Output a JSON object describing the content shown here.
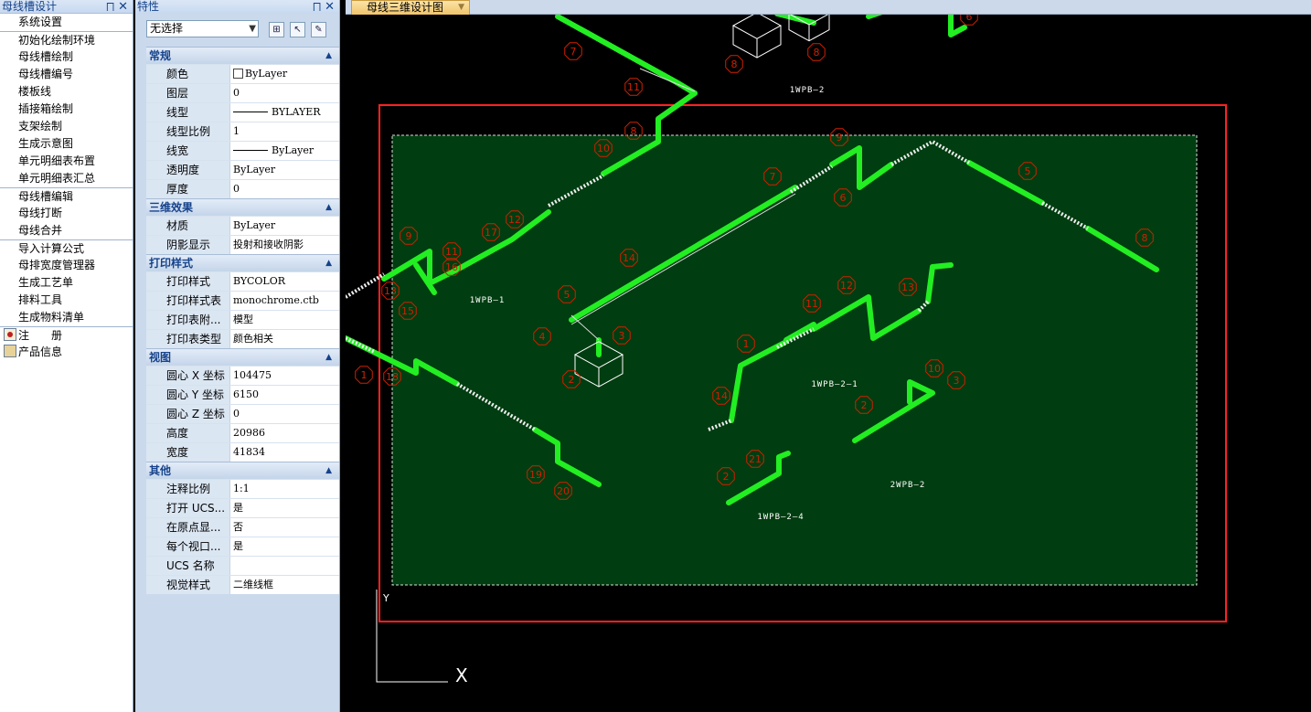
{
  "left_panel": {
    "title": "母线槽设计",
    "pin_icon": "pin-icon",
    "close_icon": "close-icon",
    "items": [
      {
        "label": "系统设置",
        "sep": false
      },
      {
        "label": "初始化绘制环境",
        "sep": true
      },
      {
        "label": "母线槽绘制",
        "sep": false
      },
      {
        "label": "母线槽编号",
        "sep": false
      },
      {
        "label": "楼板线",
        "sep": false
      },
      {
        "label": "插接箱绘制",
        "sep": false
      },
      {
        "label": "支架绘制",
        "sep": false
      },
      {
        "label": "生成示意图",
        "sep": false
      },
      {
        "label": "单元明细表布置",
        "sep": false
      },
      {
        "label": "单元明细表汇总",
        "sep": false
      },
      {
        "label": "母线槽编辑",
        "sep": true
      },
      {
        "label": "母线打断",
        "sep": false
      },
      {
        "label": "母线合并",
        "sep": false
      },
      {
        "label": "导入计算公式",
        "sep": true
      },
      {
        "label": "母排宽度管理器",
        "sep": false
      },
      {
        "label": "生成工艺单",
        "sep": false
      },
      {
        "label": "排料工具",
        "sep": false
      },
      {
        "label": "生成物料清单",
        "sep": false
      },
      {
        "label": "注　　册",
        "sep": true,
        "icon": "register-icon"
      },
      {
        "label": "产品信息",
        "sep": false,
        "icon": "product-info-icon"
      }
    ]
  },
  "properties_panel": {
    "title": "特性",
    "selection": "无选择",
    "sections": [
      {
        "name": "常规",
        "rows": [
          {
            "key": "颜色",
            "value": "ByLayer",
            "kind": "color"
          },
          {
            "key": "图层",
            "value": "0"
          },
          {
            "key": "线型",
            "value": "BYLAYER",
            "kind": "line"
          },
          {
            "key": "线型比例",
            "value": "1"
          },
          {
            "key": "线宽",
            "value": "ByLayer",
            "kind": "line"
          },
          {
            "key": "透明度",
            "value": "ByLayer"
          },
          {
            "key": "厚度",
            "value": "0"
          }
        ]
      },
      {
        "name": "三维效果",
        "rows": [
          {
            "key": "材质",
            "value": "ByLayer"
          },
          {
            "key": "阴影显示",
            "value": "投射和接收阴影"
          }
        ]
      },
      {
        "name": "打印样式",
        "rows": [
          {
            "key": "打印样式",
            "value": "BYCOLOR"
          },
          {
            "key": "打印样式表",
            "value": "monochrome.ctb"
          },
          {
            "key": "打印表附...",
            "value": "模型"
          },
          {
            "key": "打印表类型",
            "value": "颜色相关"
          }
        ]
      },
      {
        "name": "视图",
        "rows": [
          {
            "key": "圆心 X 坐标",
            "value": "104475"
          },
          {
            "key": "圆心 Y 坐标",
            "value": "6150"
          },
          {
            "key": "圆心 Z 坐标",
            "value": "0"
          },
          {
            "key": "高度",
            "value": "20986"
          },
          {
            "key": "宽度",
            "value": "41834"
          }
        ]
      },
      {
        "name": "其他",
        "rows": [
          {
            "key": "注释比例",
            "value": "1:1"
          },
          {
            "key": "打开 UCS...",
            "value": "是"
          },
          {
            "key": "在原点显...",
            "value": "否"
          },
          {
            "key": "每个视口...",
            "value": "是"
          },
          {
            "key": "UCS 名称",
            "value": ""
          },
          {
            "key": "视觉样式",
            "value": "二维线框"
          }
        ]
      }
    ]
  },
  "drawing": {
    "tab_title": "母线三维设计图",
    "colors": {
      "busbar": "#22ee22",
      "frame": "#ff2222",
      "area": "#003d10",
      "label": "#d02000"
    },
    "labels": [
      "1WPB—2",
      "1WPB—1",
      "1WPB—2—1",
      "2WPB—2",
      "1WPB—2—4"
    ],
    "markers": [
      "7",
      "8",
      "11",
      "8",
      "6",
      "8",
      "9",
      "10",
      "6",
      "7",
      "5",
      "8",
      "9",
      "17",
      "12",
      "11",
      "16",
      "13",
      "15",
      "14",
      "5",
      "4",
      "3",
      "2",
      "1",
      "11",
      "12",
      "13",
      "14",
      "10",
      "3",
      "2",
      "1",
      "18",
      "19",
      "20",
      "21",
      "2",
      "1"
    ],
    "axis_labels": [
      "Y",
      "X"
    ]
  }
}
